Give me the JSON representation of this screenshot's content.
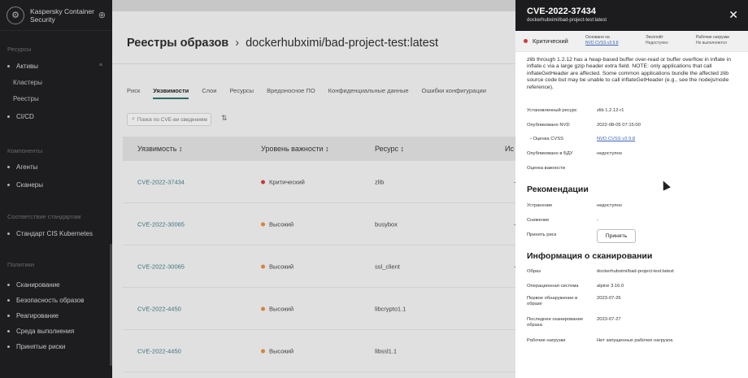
{
  "sidebar": {
    "brand": "Kaspersky Container Security",
    "sections": {
      "resources": "Ресурсы",
      "components": "Компоненты",
      "compliance": "Соответствие стандартам",
      "policies": "Политики"
    },
    "items": {
      "assets": "Активы",
      "clusters": "Кластеры",
      "registries": "Реестры",
      "cicd": "CI/CD",
      "agents": "Агенты",
      "scanners": "Сканеры",
      "cis": "Стандарт CIS Kubernetes",
      "scanning": "Сканирование",
      "image_security": "Безопасность образов",
      "response": "Реагирование",
      "runtime": "Среда выполнения",
      "accepted_risks": "Принятые риски"
    }
  },
  "main": {
    "breadcrumb_root": "Реестры образов",
    "breadcrumb_sep": "›",
    "image_name": "dockerhubximi/bad-project-test:latest",
    "tabs": [
      "Риск",
      "Уязвимости",
      "Слои",
      "Ресурсы",
      "Вредоносное ПО",
      "Конфиденциальные данные",
      "Ошибки конфигурации"
    ],
    "search_placeholder": "Поиск по CVE-ви сведениям",
    "columns": {
      "vuln": "Уязвимость ↕",
      "severity": "Уровень важности ↕",
      "resource": "Ресурс ↕",
      "extra": "Ис"
    },
    "rows": [
      {
        "cve": "CVE-2022-37434",
        "severity": "Критический",
        "sev_color": "#d23a3a",
        "resource": "zlib",
        "mark": "-"
      },
      {
        "cve": "CVE-2022-30065",
        "severity": "Высокий",
        "sev_color": "#e08a3a",
        "resource": "busybox",
        "mark": "-"
      },
      {
        "cve": "CVE-2022-30065",
        "severity": "Высокий",
        "sev_color": "#e08a3a",
        "resource": "ssl_client",
        "mark": "-"
      },
      {
        "cve": "CVE-2022-4450",
        "severity": "Высокий",
        "sev_color": "#e08a3a",
        "resource": "libcrypto1.1",
        "mark": "✓"
      },
      {
        "cve": "CVE-2022-4450",
        "severity": "Высокий",
        "sev_color": "#e08a3a",
        "resource": "libssl1.1",
        "mark": "✓"
      }
    ]
  },
  "panel": {
    "title": "CVE-2022-37434",
    "subtitle": "dockerhubximi/bad-project-test:latest",
    "severity": "Критический",
    "based_on_label": "Основано на",
    "based_on_value": "NVD CVSS v3 9.8",
    "exploit_label": "Эксплойт",
    "exploit_value": "Недоступен",
    "workloads_label": "Рабочие нагрузки",
    "workloads_value": "Не выполняется",
    "description": "zlib through 1.2.12 has a heap-based buffer over-read or buffer overflow in inflate in inflate.c via a large gzip header extra field. NOTE: only applications that call inflateGetHeader are affected. Some common applications bundle the affected zlib source code but may be unable to call inflateGetHeader (e.g., see the nodejs/node reference).",
    "details": [
      {
        "k": "Установленный ресурс",
        "v": "zlib 1.2.12-r1"
      },
      {
        "k": "Опубликовано NVD",
        "v": "2022-08-05 07:15:00"
      },
      {
        "k": "› Оценка CVSS",
        "v": "NVD CVSS v3 9.8"
      },
      {
        "k": "Опубликовано в БДУ",
        "v": "недоступно"
      },
      {
        "k": "Оценка важности",
        "v": ""
      }
    ],
    "recommendations_title": "Рекомендации",
    "recommendations": [
      {
        "k": "Устранение",
        "v": "недоступно"
      },
      {
        "k": "Снижение",
        "v": "-"
      },
      {
        "k": "Принять риск",
        "v": ""
      }
    ],
    "accept_button": "Принять",
    "scan_title": "Информация о сканировании",
    "scan": [
      {
        "k": "Образ",
        "v": "dockerhubximi/bad-project-test:latest"
      },
      {
        "k": "Операционная система",
        "v": "alpine 3.16.0"
      },
      {
        "k": "Первое обнаружение в образе",
        "v": "2023-07-26"
      },
      {
        "k": "Последнее сканирование образа",
        "v": "2023-07-27"
      },
      {
        "k": "Рабочие нагрузки",
        "v": "Нет запущенных рабочих нагрузок."
      }
    ]
  }
}
